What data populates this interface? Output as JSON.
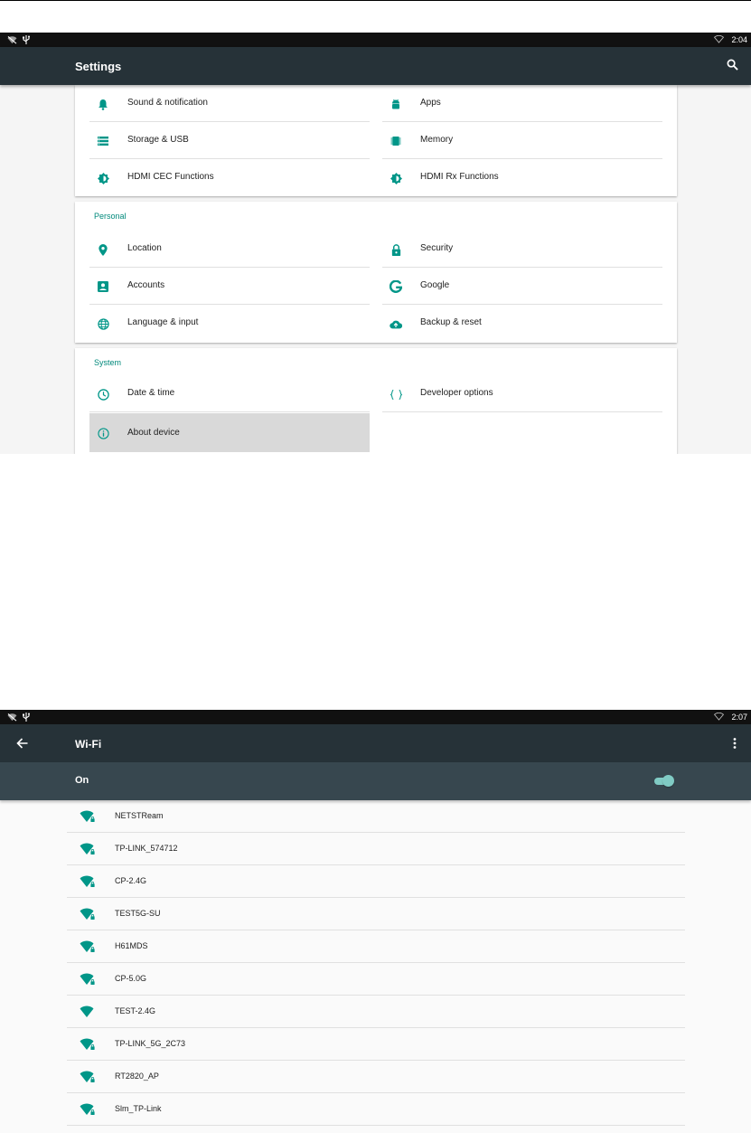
{
  "screen1": {
    "status": {
      "time": "2:04"
    },
    "toolbar": {
      "title": "Settings"
    },
    "device_items": [
      {
        "label": "Sound & notification",
        "icon": "bell-icon"
      },
      {
        "label": "Apps",
        "icon": "android-icon"
      },
      {
        "label": "Storage & USB",
        "icon": "storage-icon"
      },
      {
        "label": "Memory",
        "icon": "memory-chip-icon"
      },
      {
        "label": "HDMI CEC Functions",
        "icon": "brightness-icon"
      },
      {
        "label": "HDMI Rx Functions",
        "icon": "brightness-icon"
      }
    ],
    "personal": {
      "header": "Personal",
      "items": [
        {
          "label": "Location",
          "icon": "location-pin-icon"
        },
        {
          "label": "Security",
          "icon": "lock-icon"
        },
        {
          "label": "Accounts",
          "icon": "account-box-icon"
        },
        {
          "label": "Google",
          "icon": "google-icon"
        },
        {
          "label": "Language & input",
          "icon": "globe-icon"
        },
        {
          "label": "Backup & reset",
          "icon": "cloud-upload-icon"
        }
      ]
    },
    "system": {
      "header": "System",
      "items": [
        {
          "label": "Date & time",
          "icon": "clock-icon"
        },
        {
          "label": "Developer options",
          "icon": "braces-icon"
        },
        {
          "label": "About device",
          "icon": "info-icon",
          "selected": true
        }
      ]
    }
  },
  "screen2": {
    "status": {
      "time": "2:07"
    },
    "toolbar": {
      "title": "Wi-Fi"
    },
    "switch": {
      "label": "On",
      "state": "on"
    },
    "networks": [
      {
        "ssid": "NETSTReam",
        "secured": true
      },
      {
        "ssid": "TP-LINK_574712",
        "secured": true
      },
      {
        "ssid": "CP-2.4G",
        "secured": true
      },
      {
        "ssid": "TEST5G-SU",
        "secured": true
      },
      {
        "ssid": "H61MDS",
        "secured": true
      },
      {
        "ssid": "CP-5.0G",
        "secured": true
      },
      {
        "ssid": "TEST-2.4G",
        "secured": false
      },
      {
        "ssid": "TP-LINK_5G_2C73",
        "secured": true
      },
      {
        "ssid": "RT2820_AP",
        "secured": true
      },
      {
        "ssid": "Slm_TP-Link",
        "secured": true
      }
    ]
  },
  "colors": {
    "accent": "#009688",
    "appbar": "#263238",
    "switchbar": "#37474f",
    "toggle": "#80cbc4"
  }
}
